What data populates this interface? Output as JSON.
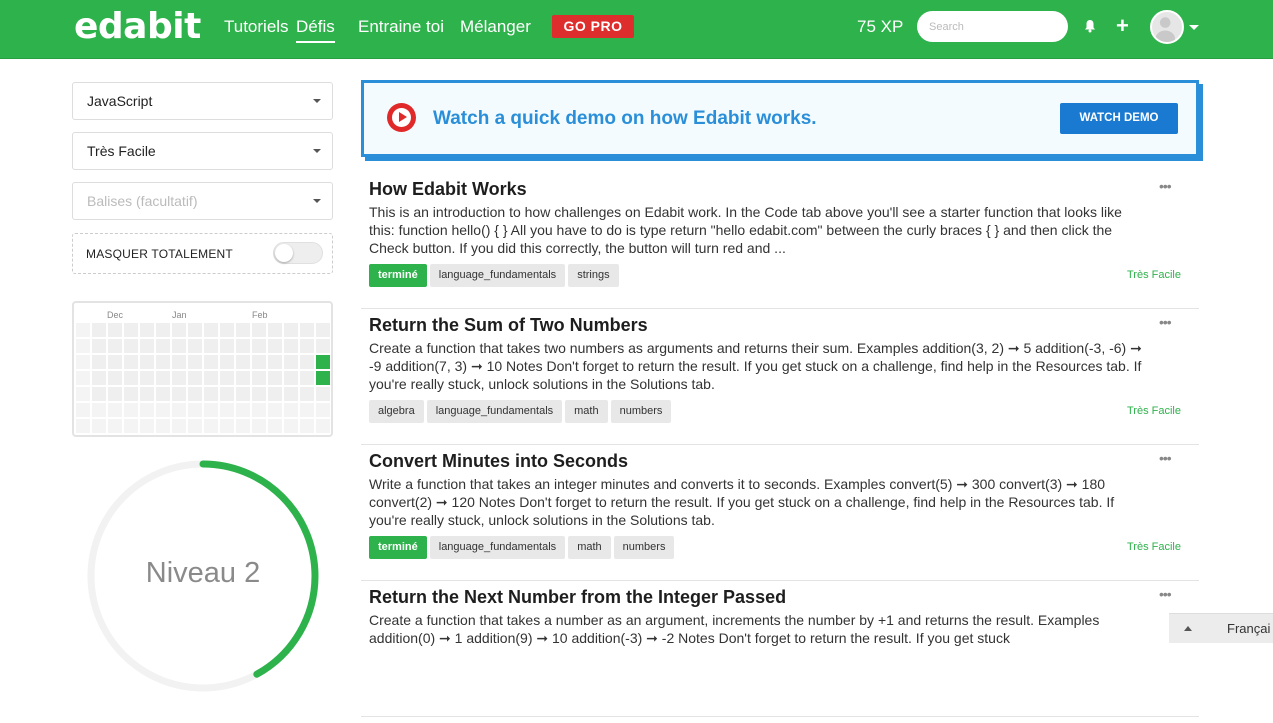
{
  "navbar": {
    "logo": "edabit",
    "links": [
      "Tutoriels",
      "Défis",
      "Entraine toi",
      "Mélanger"
    ],
    "active_link": "Défis",
    "gopro": "GO PRO",
    "xp": "75 XP",
    "search_placeholder": "Search",
    "colors": {
      "bar": "#2eb24b",
      "gopro": "#de2d2d"
    }
  },
  "sidebar": {
    "language_select": "JavaScript",
    "difficulty_select": "Très Facile",
    "tags_placeholder": "Balises (facultatif)",
    "hide_label": "MASQUER TOTALEMENT",
    "hide_toggle_on": false,
    "heatmap_months": [
      "Dec",
      "Jan",
      "Feb"
    ],
    "level_label": "Niveau 2",
    "level_progress": 0.42
  },
  "demo": {
    "text": "Watch a quick demo on how Edabit works.",
    "button": "WATCH DEMO"
  },
  "challenges": [
    {
      "title": "How Edabit Works",
      "description": "This is an introduction to how challenges on Edabit work. In the Code tab above you'll see a starter function that looks like this: function hello() { } All you have to do is type return \"hello edabit.com\" between the curly braces { } and then click the Check button. If you did this correctly, the button will turn red and ...",
      "tags": [
        "terminé",
        "language_fundamentals",
        "strings"
      ],
      "done": true,
      "difficulty": "Très Facile"
    },
    {
      "title": "Return the Sum of Two Numbers",
      "description": "Create a function that takes two numbers as arguments and returns their sum. Examples addition(3, 2) ➞ 5 addition(-3, -6) ➞ -9 addition(7, 3) ➞ 10 Notes Don't forget to return the result. If you get stuck on a challenge, find help in the Resources tab. If you're really stuck, unlock solutions in the Solutions tab.",
      "tags": [
        "algebra",
        "language_fundamentals",
        "math",
        "numbers"
      ],
      "done": false,
      "difficulty": "Très Facile"
    },
    {
      "title": "Convert Minutes into Seconds",
      "description": "Write a function that takes an integer minutes and converts it to seconds. Examples convert(5) ➞ 300 convert(3) ➞ 180 convert(2) ➞ 120 Notes Don't forget to return the result. If you get stuck on a challenge, find help in the Resources tab. If you're really stuck, unlock solutions in the Solutions tab.",
      "tags": [
        "terminé",
        "language_fundamentals",
        "math",
        "numbers"
      ],
      "done": true,
      "difficulty": "Très Facile"
    },
    {
      "title": "Return the Next Number from the Integer Passed",
      "description": "Create a function that takes a number as an argument, increments the number by +1 and returns the result. Examples addition(0) ➞ 1 addition(9) ➞ 10 addition(-3) ➞ -2 Notes Don't forget to return the result. If you get stuck",
      "tags": [],
      "done": false,
      "difficulty": "Très Facile"
    }
  ],
  "more_icon": "•••",
  "footer": {
    "language": "Françai"
  }
}
